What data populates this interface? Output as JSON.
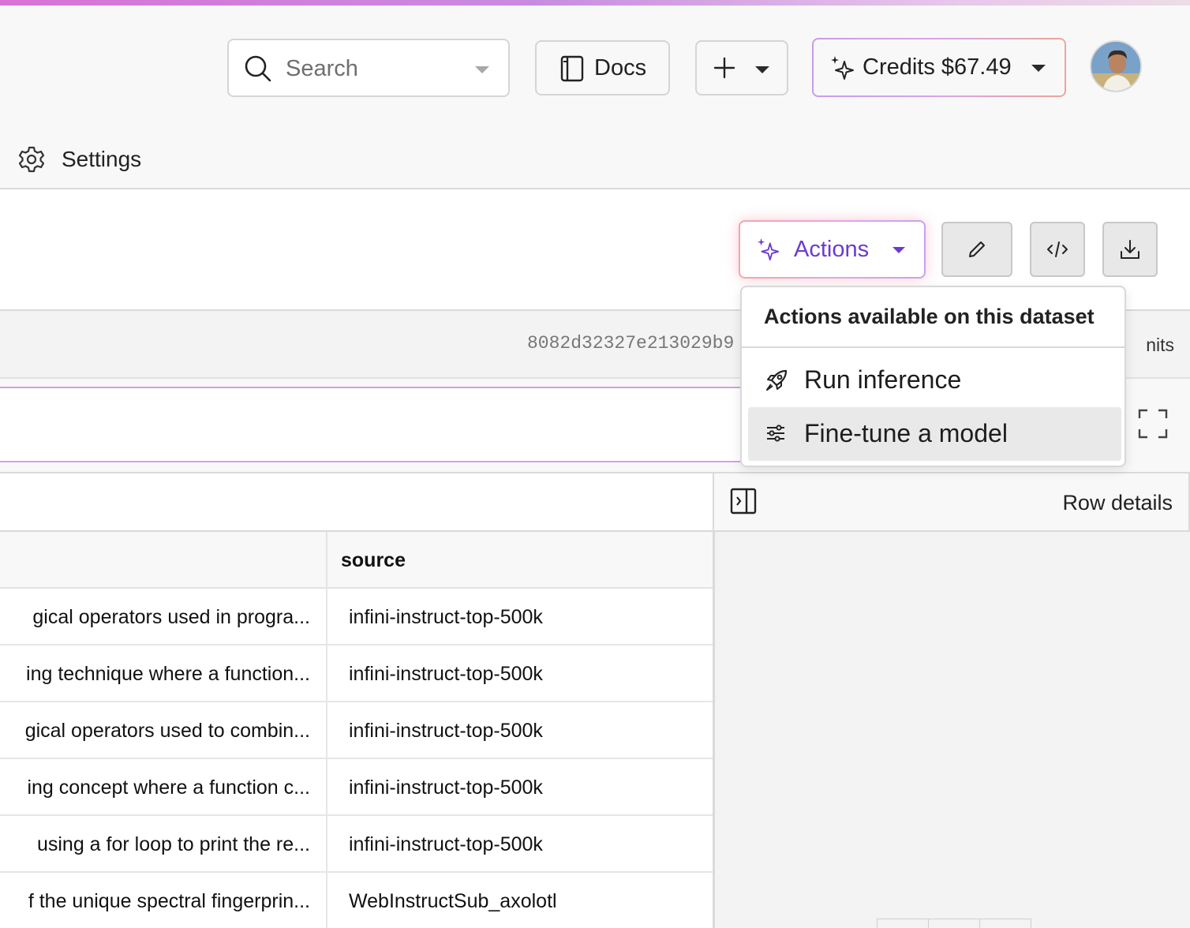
{
  "header": {
    "search_placeholder": "Search",
    "docs_label": "Docs",
    "credits_label": "Credits $67.49"
  },
  "nav": {
    "settings_label": "Settings"
  },
  "toolbar": {
    "actions_label": "Actions"
  },
  "dataset": {
    "commit_hash": "8082d32327e213029b9",
    "commits_label": "nits"
  },
  "actions_menu": {
    "heading": "Actions available on this dataset",
    "items": [
      {
        "label": "Run inference",
        "icon": "rocket-icon"
      },
      {
        "label": "Fine-tune a model",
        "icon": "sliders-icon"
      }
    ]
  },
  "row_details": {
    "title": "Row details"
  },
  "table": {
    "columns": [
      "",
      "source"
    ],
    "rows": [
      {
        "text": "gical operators used in progra...",
        "source": "infini-instruct-top-500k"
      },
      {
        "text": "ing technique where a function...",
        "source": "infini-instruct-top-500k"
      },
      {
        "text": "gical operators used to combin...",
        "source": "infini-instruct-top-500k"
      },
      {
        "text": "ing concept where a function c...",
        "source": "infini-instruct-top-500k"
      },
      {
        "text": "using a for loop to print the re...",
        "source": "infini-instruct-top-500k"
      },
      {
        "text": "f the unique spectral fingerprin...",
        "source": "WebInstructSub_axolotl"
      }
    ]
  },
  "colors": {
    "accent_purple": "#6a3bd1",
    "gradient_pink": "#d873d6"
  }
}
